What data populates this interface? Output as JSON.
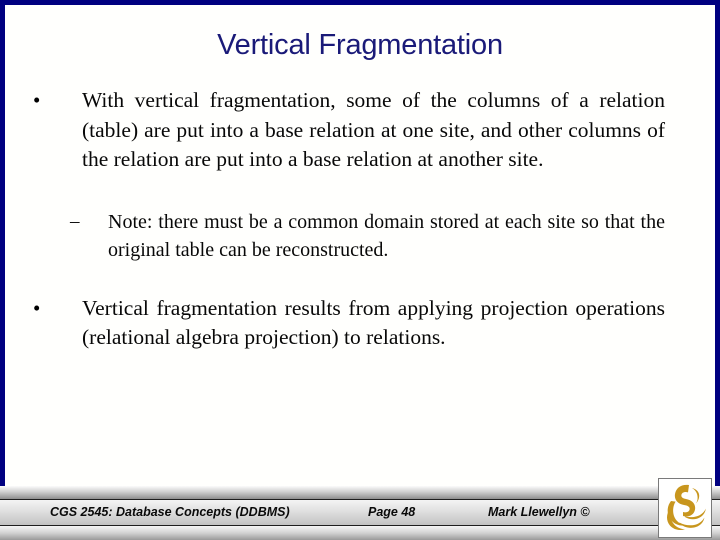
{
  "slide": {
    "title": "Vertical Fragmentation",
    "background_color": "#fffffe",
    "frame_color": "#000080",
    "title_color": "#1a1a78",
    "bullets": [
      {
        "level": 1,
        "marker": "•",
        "text": "With vertical fragmentation, some of the columns of a relation (table) are put into a base relation at one site, and other columns of the relation are put into a base relation at another site."
      },
      {
        "level": 2,
        "marker": "–",
        "text": "Note: there must be a common domain stored at each site so that the original table can be reconstructed."
      },
      {
        "level": 1,
        "marker": "•",
        "text": "Vertical fragmentation results from applying projection operations (relational algebra projection) to relations."
      }
    ]
  },
  "footer": {
    "course": "CGS 2545: Database Concepts  (DDBMS)",
    "page": "Page 48",
    "author": "Mark Llewellyn ©",
    "logo_name": "pegasus-logo",
    "logo_color": "#c8961e"
  }
}
